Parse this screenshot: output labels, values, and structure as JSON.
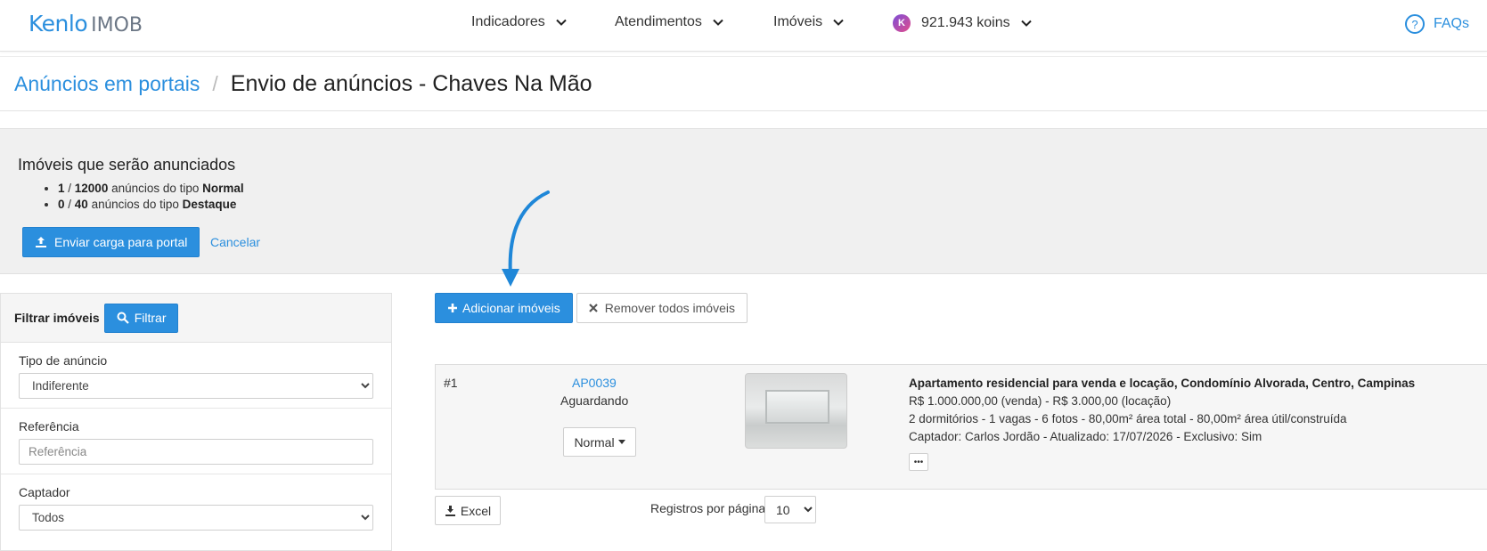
{
  "header": {
    "logo_main": "Kenlo",
    "logo_sub": "IMOB",
    "nav": [
      {
        "label": "Indicadores"
      },
      {
        "label": "Atendimentos"
      },
      {
        "label": "Imóveis"
      }
    ],
    "koins_icon": "K",
    "koins": "921.943 koins",
    "faq": "FAQs"
  },
  "breadcrumb": {
    "parent": "Anúncios em portais",
    "separator": "/",
    "current": "Envio de anúncios - Chaves Na Mão"
  },
  "summary": {
    "title": "Imóveis que serão anunciados",
    "items": [
      {
        "count": "1",
        "sep": " / ",
        "total": "12000",
        "text": " anúncios do tipo ",
        "type": "Normal"
      },
      {
        "count": "0",
        "sep": " / ",
        "total": "40",
        "text": " anúncios do tipo ",
        "type": "Destaque"
      }
    ],
    "send_button": "Enviar carga para portal",
    "cancel": "Cancelar"
  },
  "filter": {
    "title": "Filtrar imóveis",
    "button": "Filtrar",
    "fields": {
      "tipo": {
        "label": "Tipo de anúncio",
        "value": "Indiferente"
      },
      "referencia": {
        "label": "Referência",
        "placeholder": "Referência"
      },
      "captador": {
        "label": "Captador",
        "value": "Todos"
      }
    }
  },
  "actions": {
    "add": "Adicionar imóveis",
    "remove": "Remover todos imóveis"
  },
  "results": [
    {
      "num": "#1",
      "ref": "AP0039",
      "status": "Aguardando",
      "ad_type": "Normal",
      "title": "Apartamento residencial para venda e locação, Condomínio Alvorada, Centro, Campinas",
      "price": "R$ 1.000.000,00 (venda) - R$ 3.000,00 (locação)",
      "details": "2 dormitórios - 1 vagas - 6 fotos - 80,00m² área total - 80,00m² área útil/construída",
      "meta": "Captador: Carlos Jordão - Atualizado: 17/07/2026 - Exclusivo: Sim",
      "more": "•••"
    }
  ],
  "footer": {
    "excel": "Excel",
    "per_page_label": "Registros por página",
    "per_page_value": "10"
  },
  "colors": {
    "accent": "#2b8fde",
    "annotation_arrow": "#1f87d8"
  }
}
